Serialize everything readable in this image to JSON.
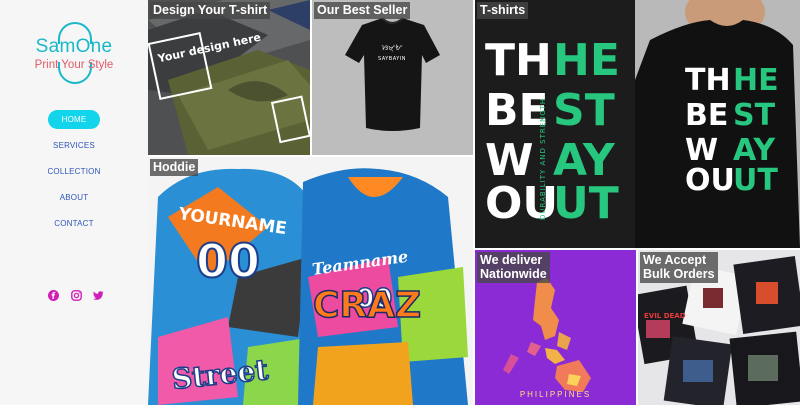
{
  "brand": {
    "name": "SamOne",
    "tagline": "Print Your Style",
    "colors": {
      "primary": "#19b8c9",
      "accent": "#e05a66",
      "nav_text": "#2e55b8",
      "social": "#d01fb8"
    }
  },
  "nav": {
    "items": [
      {
        "label": "HOME",
        "active": true
      },
      {
        "label": "SERVICES",
        "active": false
      },
      {
        "label": "COLLECTION",
        "active": false
      },
      {
        "label": "ABOUT",
        "active": false
      },
      {
        "label": "CONTACT",
        "active": false
      }
    ]
  },
  "social": {
    "icons": [
      "facebook-icon",
      "instagram-icon",
      "twitter-icon"
    ]
  },
  "tiles": {
    "design": {
      "label": "Design Your T-shirt",
      "print_text": "Your design here"
    },
    "best_seller": {
      "label": "Our Best Seller",
      "print_text": "ᜐᜋ᜔ᜀ\nSAYBAYIN"
    },
    "tshirts": {
      "label": "T-shirts",
      "print_left": "TH\nBE\nW\nOU",
      "print_right": "HE\nST\nAY\nUT",
      "print_side": "DURABILITY AND STRENGTH"
    },
    "hoodie": {
      "label": "Hoddie",
      "print_text": "YOURNAME",
      "print_number": "00",
      "print_team": "Teamname",
      "print_street": "Street",
      "print_craz": "CRAZ"
    },
    "deliver": {
      "label": "We deliver\nNationwide",
      "map_caption": "PHILIPPINES"
    },
    "bulk": {
      "label": "We Accept\nBulk Orders",
      "shirt_text": "EVIL DEAD"
    }
  }
}
